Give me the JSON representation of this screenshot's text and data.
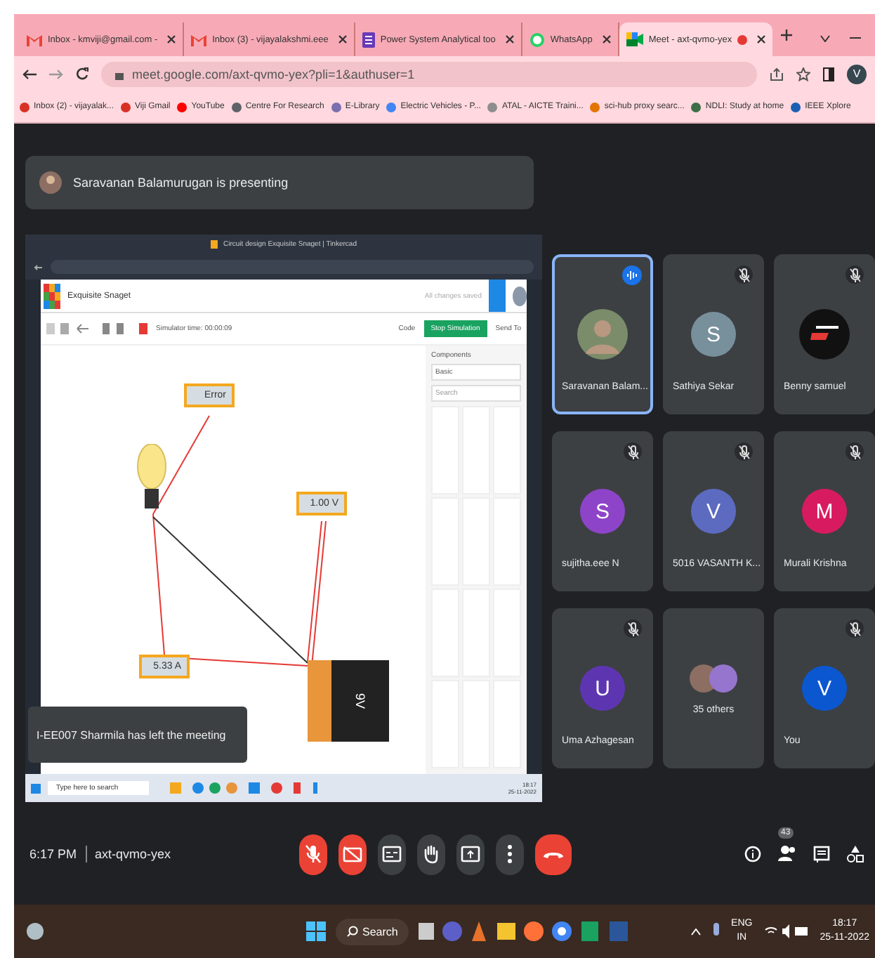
{
  "browser": {
    "tabs": [
      {
        "title": "Inbox - kmviji@gmail.com -",
        "kind": "gmail",
        "selected": false
      },
      {
        "title": "Inbox (3) - vijayalakshmi.eee",
        "kind": "gmail",
        "selected": false
      },
      {
        "title": "Power System Analytical too",
        "kind": "doc",
        "selected": false
      },
      {
        "title": "WhatsApp",
        "kind": "whatsapp",
        "selected": false
      },
      {
        "title": "Meet - axt-qvmo-yex",
        "kind": "meet",
        "selected": true
      }
    ],
    "address": "meet.google.com/axt-qvmo-yex?pli=1&authuser=1",
    "profile": "V",
    "bookmarks": [
      {
        "title": "Inbox (2) - vijayalak...",
        "color": "#d93025"
      },
      {
        "title": "Viji Gmail",
        "color": "#d93025"
      },
      {
        "title": "YouTube",
        "color": "#ff0000"
      },
      {
        "title": "Centre For Research",
        "color": "#5f6368"
      },
      {
        "title": "E-Library",
        "color": "#7b6fb0"
      },
      {
        "title": "Electric Vehicles - P...",
        "color": "#4285f4"
      },
      {
        "title": "ATAL - AICTE Traini...",
        "color": "#8e8e8e"
      },
      {
        "title": "sci-hub proxy searc...",
        "color": "#e37400"
      },
      {
        "title": "NDLI: Study at home",
        "color": "#3c6e47"
      },
      {
        "title": "IEEE Xplore",
        "color": "#1a5fb4"
      }
    ]
  },
  "meet": {
    "presenter": "Saravanan Balamurugan is presenting",
    "shared_screen": {
      "window_title": "Circuit design Exquisite Snaget | Tinkercad",
      "project": "Exquisite Snaget",
      "save_status": "All changes saved",
      "sim_time": "Simulator time: 00:00:09",
      "code_button": "Code",
      "stop_button": "Stop Simulation",
      "send_button": "Send To",
      "components_label": "Components",
      "components_value": "Basic",
      "search_placeholder": "Search",
      "meters": [
        {
          "reading": "Error"
        },
        {
          "reading": "1.00 V"
        },
        {
          "reading": "5.33 A"
        }
      ],
      "battery": "9V",
      "taskbar_search": "Type here to search",
      "taskbar_time": "18:17",
      "taskbar_date": "25-11-2022",
      "notification": "I-EE007 Sharmila has left the meeting"
    },
    "tiles": [
      {
        "name": "Saravanan Balam...",
        "kind": "photo",
        "speaking": true,
        "muted": false
      },
      {
        "name": "Sathiya Sekar",
        "kind": "letter",
        "letter": "S",
        "color": "#78909c",
        "speaking": false,
        "muted": true
      },
      {
        "name": "Benny samuel",
        "kind": "logo",
        "speaking": false,
        "muted": true
      },
      {
        "name": "sujitha.eee N",
        "kind": "letter",
        "letter": "S",
        "color": "#8e44c8",
        "speaking": false,
        "muted": true
      },
      {
        "name": "5016 VASANTH K...",
        "kind": "letter",
        "letter": "V",
        "color": "#5c6bc0",
        "speaking": false,
        "muted": true
      },
      {
        "name": "Murali Krishna",
        "kind": "letter",
        "letter": "M",
        "color": "#d81b60",
        "speaking": false,
        "muted": true
      },
      {
        "name": "Uma Azhagesan",
        "kind": "letter",
        "letter": "U",
        "color": "#5e35b1",
        "speaking": false,
        "muted": true
      },
      {
        "name": "35 others",
        "kind": "others",
        "speaking": false,
        "muted": false
      },
      {
        "name": "You",
        "kind": "letter",
        "letter": "V",
        "color": "#0b57d0",
        "speaking": false,
        "muted": true
      }
    ],
    "time": "6:17 PM",
    "code": "axt-qvmo-yex",
    "controls": [
      {
        "kind": "mic",
        "on": false
      },
      {
        "kind": "camera",
        "on": false
      },
      {
        "kind": "captions"
      },
      {
        "kind": "hand"
      },
      {
        "kind": "present"
      },
      {
        "kind": "more"
      },
      {
        "kind": "leave"
      }
    ],
    "participants_count": "43"
  },
  "taskbar": {
    "search": "Search",
    "language": "ENG",
    "region": "IN",
    "time": "18:17",
    "date": "25-11-2022"
  }
}
